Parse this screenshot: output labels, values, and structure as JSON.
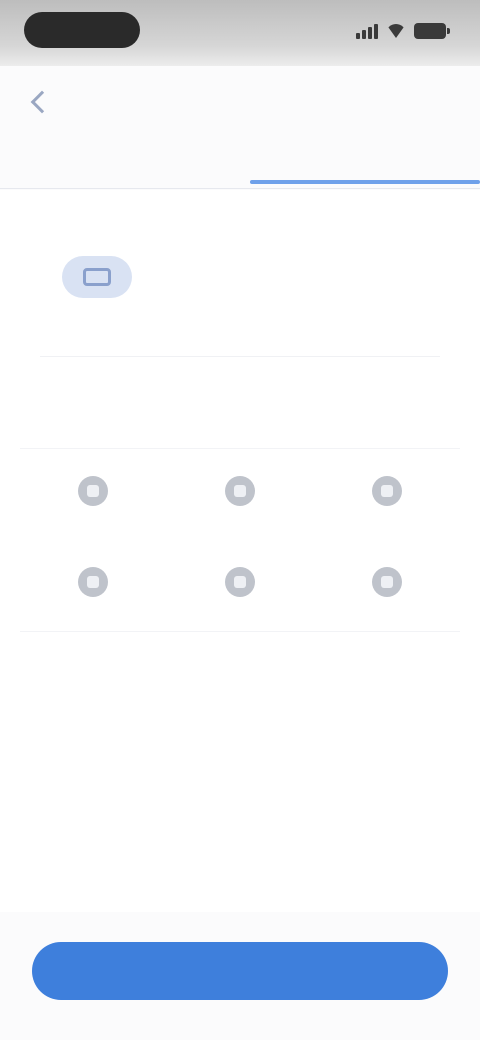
{
  "status_bar": {
    "time": "",
    "signal_bars": 4,
    "battery_level": 1.0
  },
  "header": {
    "back_icon": "chevron-left-icon"
  },
  "tabs": [
    {
      "label": "",
      "active": false
    },
    {
      "label": "",
      "active": true
    }
  ],
  "device": {
    "title": "",
    "icon": "device-icon",
    "name": "",
    "status": ""
  },
  "options": {
    "heading": "",
    "subheading": "",
    "items": [
      {
        "label": "",
        "icon": "option-icon"
      },
      {
        "label": "",
        "icon": "option-icon"
      },
      {
        "label": "",
        "icon": "option-icon"
      },
      {
        "label": "",
        "icon": "option-icon"
      },
      {
        "label": "",
        "icon": "option-icon"
      },
      {
        "label": "",
        "icon": "option-icon"
      }
    ]
  },
  "footer": {
    "confirm_label": ""
  },
  "colors": {
    "accent": "#3e7fdc",
    "tab_indicator": "#6fa1ea",
    "device_badge": "#d9e2f3"
  }
}
